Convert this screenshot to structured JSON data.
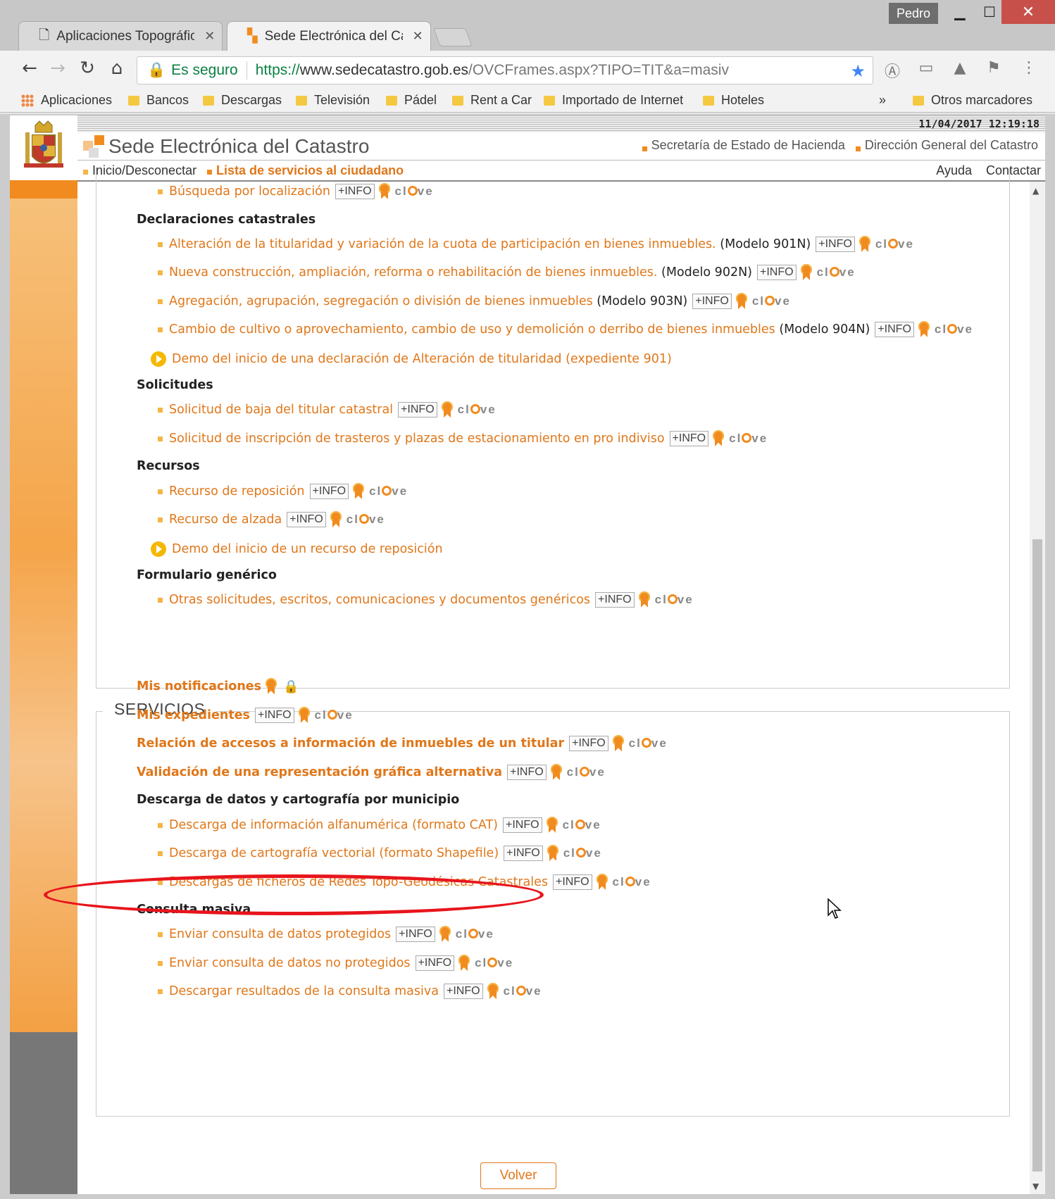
{
  "browser": {
    "tabs": [
      {
        "label": "Aplicaciones Topográfica"
      },
      {
        "label": "Sede Electrónica del Cata"
      }
    ],
    "user": "Pedro",
    "secure_label": "Es seguro",
    "url_scheme": "https://",
    "url_host": "www.sedecatastro.gob.es",
    "url_path": "/OVCFrames.aspx?TIPO=TIT&a=masiv",
    "bookmarks": [
      "Aplicaciones",
      "Bancos",
      "Descargas",
      "Televisión",
      "Pádel",
      "Rent a Car",
      "Importado de Internet",
      "Hoteles"
    ],
    "bookmarks_more": "»",
    "other_bookmarks": "Otros marcadores"
  },
  "site": {
    "datetime": "11/04/2017  12:19:18",
    "title": "Sede Electrónica del Catastro",
    "header_links": [
      "Secretaría de Estado de Hacienda",
      "Dirección General del Catastro"
    ],
    "nav": {
      "home": "Inicio/Desconectar",
      "list": "Lista de servicios al ciudadano",
      "help": "Ayuda",
      "contact": "Contactar"
    }
  },
  "info_label": "+INFO",
  "clave_prefix": "cl",
  "clave_suffix": "ve",
  "tramites": {
    "top_item": "Búsqueda por localización",
    "declaraciones_head": "Declaraciones catastrales",
    "declaraciones": [
      {
        "link": "Alteración de la titularidad y variación de la cuota de participación en bienes inmuebles.",
        "model": " (Modelo 901N)"
      },
      {
        "link": "Nueva construcción, ampliación, reforma o rehabilitación de bienes inmuebles.",
        "model": " (Modelo 902N)"
      },
      {
        "link": "Agregación, agrupación, segregación o división de bienes inmuebles",
        "model": " (Modelo 903N)"
      },
      {
        "link": "Cambio de cultivo o aprovechamiento, cambio de uso y demolición o derribo de bienes inmuebles",
        "model": " (Modelo 904N)"
      }
    ],
    "demo1": "Demo del inicio de una declaración de Alteración de titularidad (expediente 901)",
    "solicitudes_head": "Solicitudes",
    "solicitudes": [
      "Solicitud de baja del titular catastral",
      "Solicitud de inscripción de trasteros y plazas de estacionamiento en pro indiviso"
    ],
    "recursos_head": "Recursos",
    "recursos": [
      "Recurso de reposición",
      "Recurso de alzada"
    ],
    "demo2": "Demo del inicio de un recurso de reposición",
    "formulario_head": "Formulario genérico",
    "formulario": "Otras solicitudes, escritos, comunicaciones y documentos genéricos"
  },
  "servicios": {
    "legend": "SERVICIOS",
    "notificaciones": "Mis notificaciones",
    "expedientes": "Mis expedientes",
    "accesos": "Relación de accesos a información de inmuebles de un titular",
    "validacion": "Validación de una representación gráfica alternativa",
    "descarga_head": "Descarga de datos y cartografía por municipio",
    "descargas": [
      "Descarga de información alfanumérica (formato CAT)",
      "Descarga de cartografía vectorial (formato Shapefile)",
      "Descargas de ficheros de Redes Topo-Geodésicas Catastrales"
    ],
    "masiva_head": "Consulta masiva",
    "masiva": [
      "Enviar consulta de datos protegidos",
      "Enviar consulta de datos no protegidos",
      "Descargar resultados de la consulta masiva"
    ]
  },
  "back_button": "Volver",
  "colors": {
    "link_orange": "#e0771a",
    "highlight_red": "#e8141c"
  }
}
